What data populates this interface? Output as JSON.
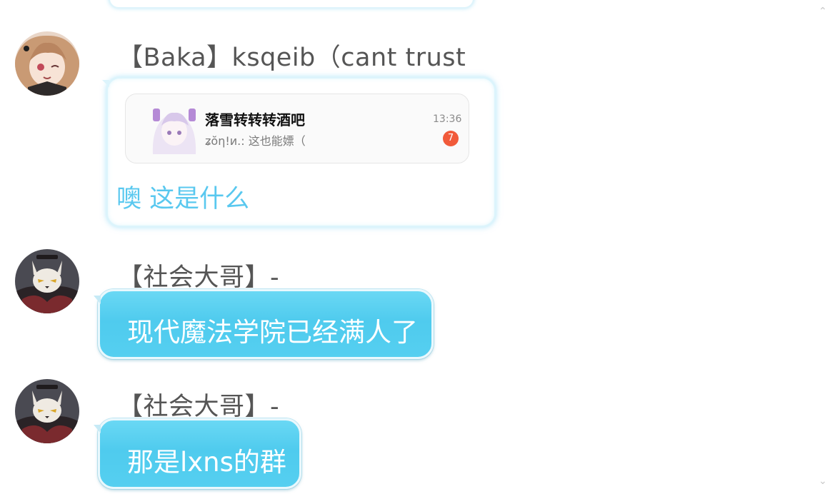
{
  "messages": [
    {
      "sender": "【Baka】ksqeib（cant trust",
      "avatar_icon": "anime-girl-avatar",
      "shared_card": {
        "title": "落雪转转转酒吧",
        "preview": "ʑŏη!и.: 这也能嫖（",
        "time": "13:36",
        "badge": "7",
        "avatar_icon": "purple-haired-anime-avatar"
      },
      "text": "噢 这是什么"
    },
    {
      "sender": "【社会大哥】-",
      "avatar_icon": "cat-mask-avatar",
      "text": "现代魔法学院已经满人了"
    },
    {
      "sender": "【社会大哥】-",
      "avatar_icon": "cat-mask-avatar",
      "text": "那是lxns的群"
    }
  ],
  "colors": {
    "bubble_blue": "#4fcbee",
    "bubble_text": "#ffffff",
    "white_bubble_text": "#59c8ef",
    "sender_text": "#555555",
    "badge": "#f15a3a",
    "background": "#ffffff"
  }
}
